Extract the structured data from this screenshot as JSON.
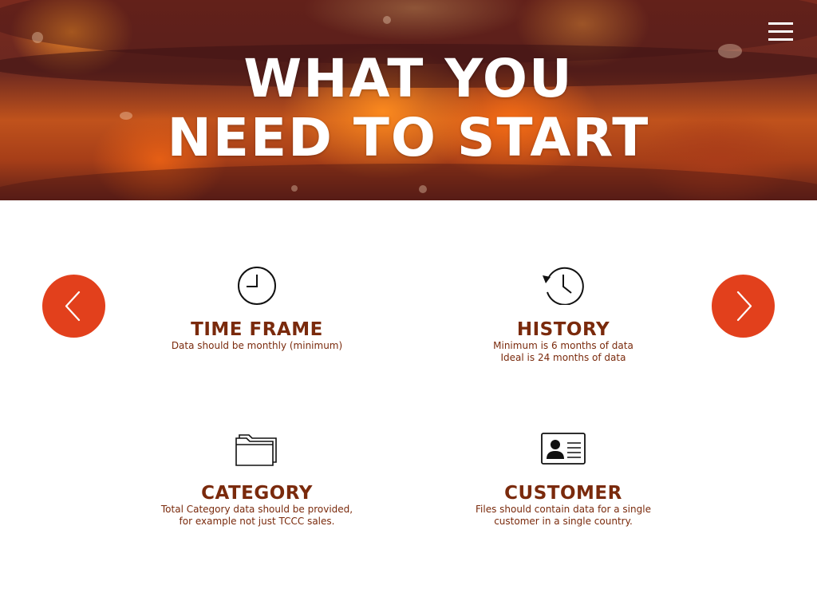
{
  "hero": {
    "title_line1": "WHAT YOU",
    "title_line2": "NEED TO START"
  },
  "menu": {
    "icon": "hamburger-menu-icon"
  },
  "navigation": {
    "prev_icon": "chevron-left-icon",
    "next_icon": "chevron-right-icon",
    "accent_color": "#e2401c"
  },
  "items": [
    {
      "icon": "clock-icon",
      "title": "TIME FRAME",
      "lines": [
        "Data should be monthly (minimum)"
      ]
    },
    {
      "icon": "history-icon",
      "title": "HISTORY",
      "lines": [
        "Minimum is 6 months of data",
        "Ideal is 24 months of data"
      ]
    },
    {
      "icon": "folder-icon",
      "title": "CATEGORY",
      "lines": [
        "Total Category data should be provided,",
        "for example not just TCCC sales."
      ]
    },
    {
      "icon": "id-card-icon",
      "title": "CUSTOMER",
      "lines": [
        "Files should contain data for a single",
        "customer in a single country."
      ]
    }
  ],
  "colors": {
    "text": "#7a2a0c",
    "accent": "#e2401c",
    "background": "#ffffff"
  }
}
